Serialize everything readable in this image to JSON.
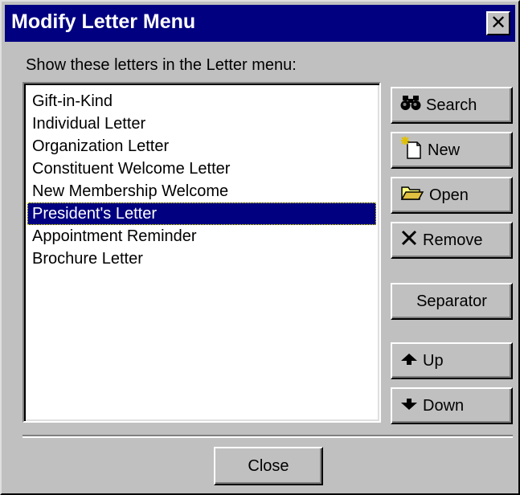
{
  "window": {
    "title": "Modify Letter Menu",
    "close_glyph": "✕"
  },
  "prompt": "Show these letters in the Letter menu:",
  "letters": [
    {
      "label": "Gift-in-Kind",
      "selected": false
    },
    {
      "label": "Individual Letter",
      "selected": false
    },
    {
      "label": "Organization Letter",
      "selected": false
    },
    {
      "label": "Constituent Welcome Letter",
      "selected": false
    },
    {
      "label": "New Membership Welcome",
      "selected": false
    },
    {
      "label": "President's Letter",
      "selected": true
    },
    {
      "label": "Appointment Reminder",
      "selected": false
    },
    {
      "label": "Brochure Letter",
      "selected": false
    }
  ],
  "buttons": {
    "search": {
      "label": "Search",
      "icon": "binoculars-icon"
    },
    "new": {
      "label": "New",
      "icon": "new-document-icon"
    },
    "open": {
      "label": "Open",
      "icon": "open-folder-icon"
    },
    "remove": {
      "label": "Remove",
      "icon": "x-icon"
    },
    "separator": {
      "label": "Separator"
    },
    "up": {
      "label": "Up",
      "icon": "arrow-up-icon"
    },
    "down": {
      "label": "Down",
      "icon": "arrow-down-icon"
    },
    "close": {
      "label": "Close"
    }
  },
  "colors": {
    "title_bar": "#000080",
    "face": "#c0c0c0",
    "selection": "#000080"
  }
}
